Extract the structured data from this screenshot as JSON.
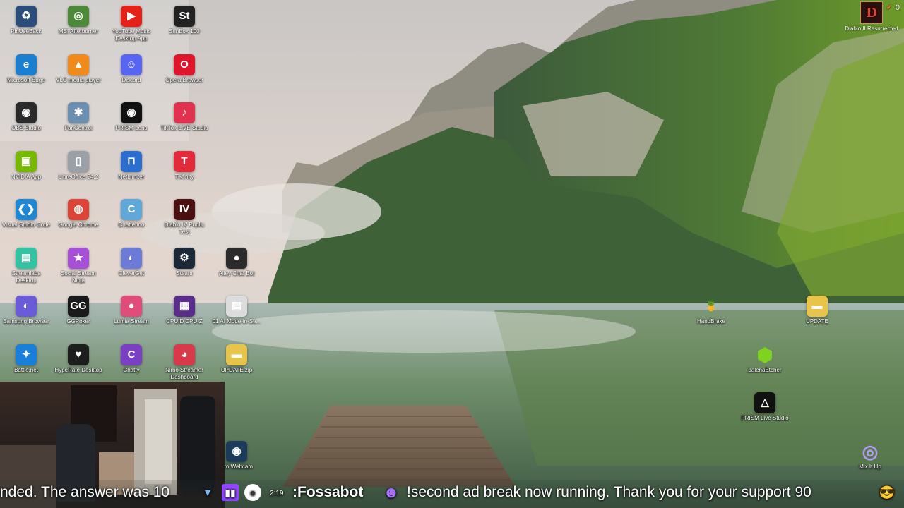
{
  "desktop": {
    "icons_col1": [
      {
        "label": "PinUseBack",
        "glyph": "♻",
        "color": "#2a4d7a",
        "icon": "recycle-icon"
      },
      {
        "label": "Microsoft Edge",
        "glyph": "e",
        "color": "#1b7fd1",
        "icon": "edge-icon"
      },
      {
        "label": "OBS Studio",
        "glyph": "◉",
        "color": "#2a2a2a",
        "icon": "obs-icon"
      },
      {
        "label": "NVIDIA App",
        "glyph": "▣",
        "color": "#76b900",
        "icon": "nvidia-icon"
      },
      {
        "label": "Visual Studio Code",
        "glyph": "❮❯",
        "color": "#1e88d4",
        "icon": "vscode-icon"
      },
      {
        "label": "Streamlabs Desktop",
        "glyph": "▤",
        "color": "#31c3a2",
        "icon": "streamlabs-icon"
      },
      {
        "label": "Samsung Browser",
        "glyph": "◐",
        "color": "#6a5cd8",
        "icon": "samsung-browser-icon"
      },
      {
        "label": "Battle.net",
        "glyph": "✦",
        "color": "#1a7fd8",
        "icon": "battlenet-icon"
      }
    ],
    "icons_col2": [
      {
        "label": "MSI Afterburner",
        "glyph": "◎",
        "color": "#4c8a3a",
        "icon": "afterburner-icon"
      },
      {
        "label": "VLC media player",
        "glyph": "▲",
        "color": "#f08a1a",
        "icon": "vlc-icon"
      },
      {
        "label": "FanControl",
        "glyph": "✱",
        "color": "#6b8fb0",
        "icon": "fancontrol-icon"
      },
      {
        "label": "LibreOffice 24.2",
        "glyph": "▯",
        "color": "#9aa0a6",
        "icon": "libreoffice-icon"
      },
      {
        "label": "Google Chrome",
        "glyph": "◍",
        "color": "#db4437",
        "icon": "chrome-icon"
      },
      {
        "label": "Social Stream Ninja",
        "glyph": "★",
        "color": "#a84fd8",
        "icon": "social-stream-icon"
      },
      {
        "label": "GGPoker",
        "glyph": "GG",
        "color": "#1a1a1a",
        "icon": "ggpoker-icon"
      },
      {
        "label": "HypeRate Desktop",
        "glyph": "♥",
        "color": "#1d1d1d",
        "icon": "hyperate-icon"
      }
    ],
    "icons_col3": [
      {
        "label": "YouTube Music Desktop App",
        "glyph": "▶",
        "color": "#e62117",
        "icon": "youtube-music-icon"
      },
      {
        "label": "Discord",
        "glyph": "☺",
        "color": "#5865f2",
        "icon": "discord-icon"
      },
      {
        "label": "PRISM Lens",
        "glyph": "◉",
        "color": "#111111",
        "icon": "prism-lens-icon"
      },
      {
        "label": "NetLimiter",
        "glyph": "⊓",
        "color": "#2a6fd0",
        "icon": "netlimiter-icon"
      },
      {
        "label": "Chatterino",
        "glyph": "C",
        "color": "#5fa8d8",
        "icon": "chatterino-icon"
      },
      {
        "label": "CleverGet",
        "glyph": "◐",
        "color": "#6c7ad8",
        "icon": "cleverget-icon"
      },
      {
        "label": "Lumia Stream",
        "glyph": "●",
        "color": "#e14d7a",
        "icon": "lumia-icon"
      },
      {
        "label": "Chatty",
        "glyph": "C",
        "color": "#7b3fc4",
        "icon": "chatty-icon"
      }
    ],
    "icons_col4": [
      {
        "label": "StinBox 100",
        "glyph": "St",
        "color": "#222222",
        "icon": "stinbox-icon"
      },
      {
        "label": "Opera Browser",
        "glyph": "O",
        "color": "#e0142a",
        "icon": "opera-icon"
      },
      {
        "label": "TikTok LIVE Studio",
        "glyph": "♪",
        "color": "#e0324f",
        "icon": "tiktok-live-icon"
      },
      {
        "label": "Tikfinity",
        "glyph": "T",
        "color": "#e22a3a",
        "icon": "tikfinity-icon"
      },
      {
        "label": "Diablo IV Public Test",
        "glyph": "IV",
        "color": "#4a1010",
        "icon": "diablo4-icon"
      },
      {
        "label": "Steam",
        "glyph": "⚙",
        "color": "#1b2838",
        "icon": "steam-icon"
      },
      {
        "label": "CPUID CPU-Z",
        "glyph": "▦",
        "color": "#5a2d8a",
        "icon": "cpuz-icon"
      },
      {
        "label": "Nimo Streamer Dashboard",
        "glyph": "◕",
        "color": "#d83a4a",
        "icon": "nimo-icon"
      }
    ],
    "icons_col5": [
      {
        "label": "Alley Chat Bot",
        "glyph": "●",
        "color": "#2b2b2b",
        "icon": "alley-chat-icon"
      },
      {
        "label": "01 AI Mode-in-Se...",
        "glyph": "▤",
        "color": "#dcdcdc",
        "icon": "file-icon"
      },
      {
        "label": "UPDATE.zip",
        "glyph": "▬",
        "color": "#e8c44a",
        "icon": "zip-folder-icon"
      },
      {
        "label": "Pro Webcam",
        "glyph": "◉",
        "color": "#1c3a5a",
        "icon": "webcam-icon"
      }
    ],
    "icons_right": [
      {
        "label": "HandBrake",
        "glyph": "🍍",
        "color": "transparent",
        "icon": "handbrake-icon"
      },
      {
        "label": "UPDATE",
        "glyph": "▬",
        "color": "#e8c44a",
        "icon": "folder-icon"
      },
      {
        "label": "balenaEtcher",
        "glyph": "⬢",
        "color": "transparent",
        "icon": "balenaetcher-icon"
      },
      {
        "label": "PRISM Live Studio",
        "glyph": "△",
        "color": "#111111",
        "icon": "prism-live-icon"
      },
      {
        "label": "Mix It Up",
        "glyph": "◎",
        "color": "transparent",
        "icon": "mixitup-icon"
      }
    ],
    "top_right_game": {
      "label": "Diablo II Resurrected",
      "glyph": "D"
    }
  },
  "overlay": {
    "notification_count": "0",
    "ticker": {
      "fragment": "nded. The answer was 10",
      "clock": "2:19",
      "bot_name": ":Fossabot",
      "message": "!second ad break now running. Thank you for your support 90"
    }
  }
}
